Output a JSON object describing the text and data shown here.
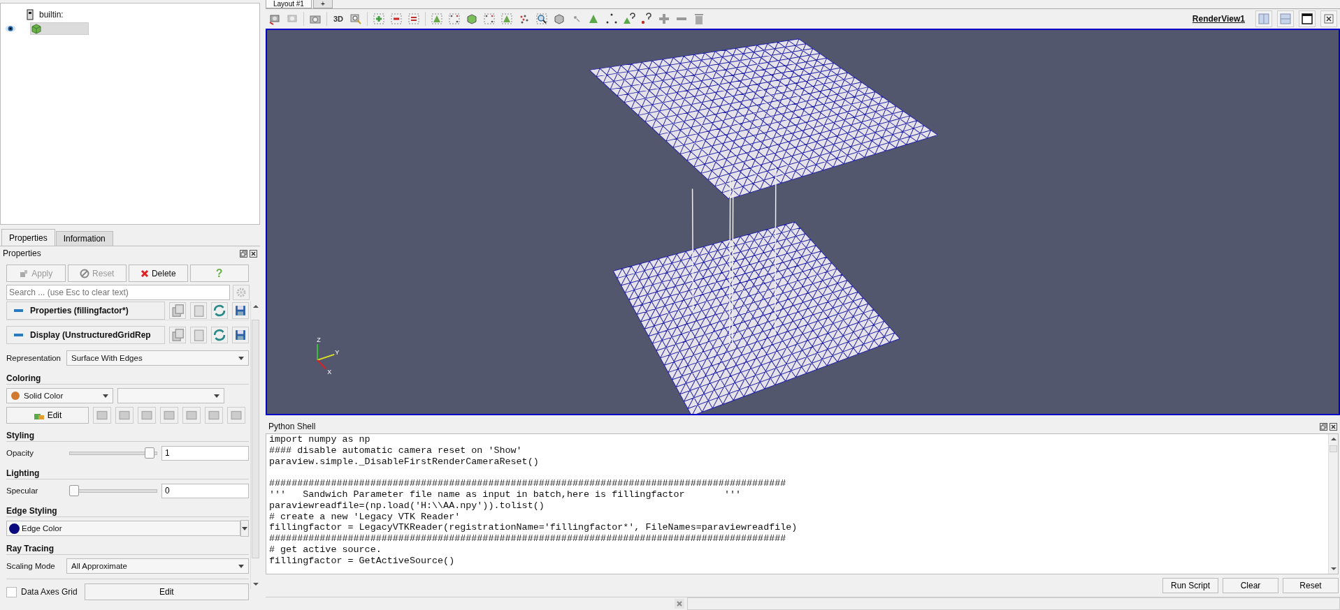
{
  "pipeline": {
    "server": "builtin:",
    "source": {
      "selected": true,
      "visible": true
    }
  },
  "panel_tabs": [
    {
      "label": "Properties",
      "selected": true
    },
    {
      "label": "Information",
      "selected": false
    }
  ],
  "properties": {
    "title": "Properties",
    "buttons": [
      {
        "kind": "apply",
        "label": "Apply",
        "disabled": true
      },
      {
        "kind": "reset",
        "label": "Reset",
        "disabled": true
      },
      {
        "kind": "delete",
        "label": "Delete",
        "disabled": false
      },
      {
        "kind": "help",
        "label": "?",
        "disabled": false
      }
    ],
    "search": {
      "placeholder": "Search ... (use Esc to clear text)"
    },
    "sections": [
      "Properties (fillingfactor*)",
      "Display (UnstructuredGridRep"
    ],
    "representation": {
      "label": "Representation",
      "value": "Surface With Edges"
    },
    "coloring": {
      "title": "Coloring",
      "mode": "Solid Color",
      "edit": "Edit"
    },
    "styling": {
      "title": "Styling",
      "label": "Opacity",
      "level": 0.96,
      "value": "1"
    },
    "lighting": {
      "title": "Lighting",
      "label": "Specular",
      "level": 0,
      "value": "0"
    },
    "edge_styling": {
      "title": "Edge Styling",
      "value": "Edge Color"
    },
    "ray_tracing": {
      "title": "Ray Tracing",
      "label": "Scaling Mode",
      "value": "All Approximate"
    },
    "axes_grid": {
      "label": "Data Axes Grid",
      "checked": false,
      "edit": "Edit"
    }
  },
  "layout_tabs": [
    {
      "label": "Layout #1",
      "selected": true
    },
    {
      "label": "+",
      "selected": false
    }
  ],
  "toolbar": {
    "mode_button": "3D"
  },
  "view": {
    "title": "RenderView1",
    "axis_labels": {
      "z": "Z",
      "y": "Y",
      "x": "X"
    }
  },
  "python_shell": {
    "title": "Python Shell",
    "blocks": [
      [
        "import numpy as np",
        "#### disable automatic camera reset on 'Show'",
        "paraview.simple._DisableFirstRenderCameraReset()"
      ],
      [
        "############################################################################################",
        "'''   Sandwich Parameter file name as input in batch,here is fillingfactor       '''",
        "paraviewreadfile=(np.load('H:\\\\AA.npy')).tolist()",
        "# create a new 'Legacy VTK Reader'",
        "fillingfactor = LegacyVTKReader(registrationName='fillingfactor*', FileNames=paraviewreadfile)",
        "############################################################################################",
        "# get active source.",
        "fillingfactor = GetActiveSource()"
      ]
    ],
    "buttons": [
      "Run Script",
      "Clear",
      "Reset"
    ]
  }
}
